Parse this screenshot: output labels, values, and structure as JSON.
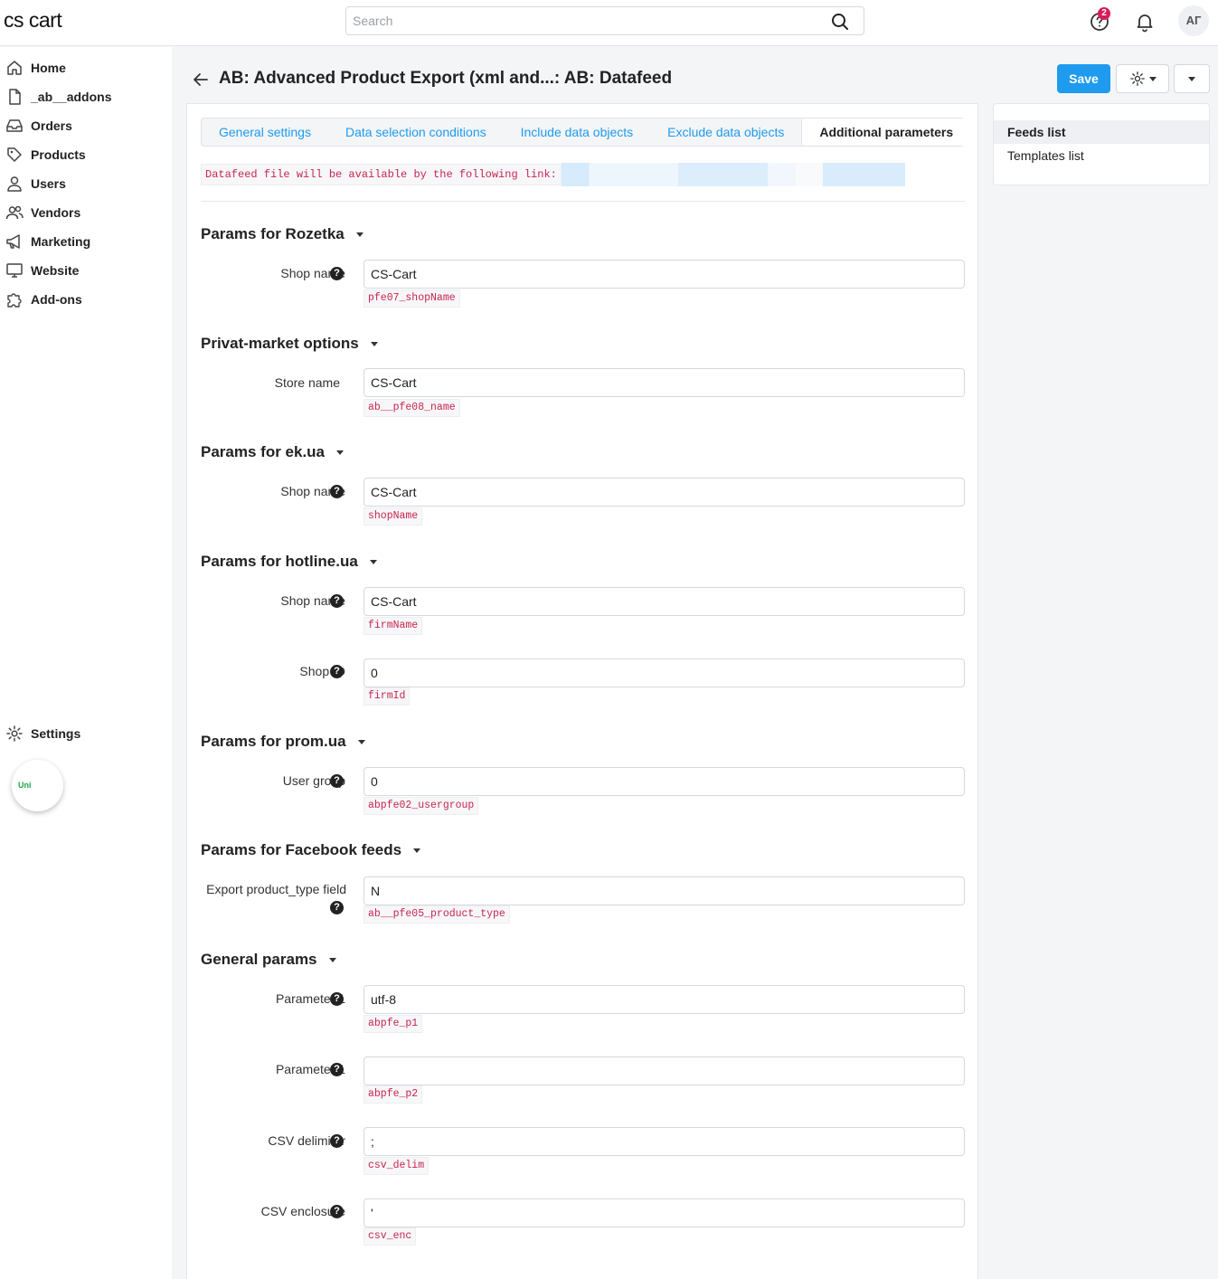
{
  "topbar": {
    "logo": "cs cart",
    "search_placeholder": "Search",
    "notification_count": "2",
    "avatar_initials": "АГ"
  },
  "sidebar": {
    "items": [
      {
        "label": "Home",
        "icon": "home-icon"
      },
      {
        "label": "_ab__addons",
        "icon": "file-icon"
      },
      {
        "label": "Orders",
        "icon": "inbox-icon"
      },
      {
        "label": "Products",
        "icon": "tag-icon"
      },
      {
        "label": "Users",
        "icon": "user-icon"
      },
      {
        "label": "Vendors",
        "icon": "users-icon"
      },
      {
        "label": "Marketing",
        "icon": "megaphone-icon"
      },
      {
        "label": "Website",
        "icon": "monitor-icon"
      },
      {
        "label": "Add-ons",
        "icon": "puzzle-icon"
      }
    ],
    "settings_label": "Settings",
    "uni_label": "Uni"
  },
  "header": {
    "title": "AB: Advanced Product Export (xml and...: AB: Datafeed",
    "save_label": "Save"
  },
  "tabs": [
    {
      "label": "General settings"
    },
    {
      "label": "Data selection conditions"
    },
    {
      "label": "Include data objects"
    },
    {
      "label": "Exclude data objects"
    },
    {
      "label": "Additional parameters"
    }
  ],
  "link_notice": "Datafeed file will be available by the following link:",
  "sections": {
    "rozetka": {
      "title": "Params for Rozetka",
      "rows": [
        {
          "label": "Shop name",
          "value": "CS-Cart",
          "tag": "pfe07_shopName"
        }
      ]
    },
    "privat": {
      "title": "Privat-market options",
      "rows": [
        {
          "label": "Store name",
          "value": "CS-Cart",
          "tag": "ab__pfe08_name"
        }
      ]
    },
    "ekua": {
      "title": "Params for ek.ua",
      "rows": [
        {
          "label": "Shop name",
          "value": "CS-Cart",
          "tag": "shopName"
        }
      ]
    },
    "hotline": {
      "title": "Params for hotline.ua",
      "rows": [
        {
          "label": "Shop name",
          "value": "CS-Cart",
          "tag": "firmName"
        },
        {
          "label": "Shop ID",
          "value": "0",
          "tag": "firmId"
        }
      ]
    },
    "prom": {
      "title": "Params for prom.ua",
      "rows": [
        {
          "label": "User group",
          "value": "0",
          "tag": "abpfe02_usergroup"
        }
      ]
    },
    "facebook": {
      "title": "Params for Facebook feeds",
      "rows": [
        {
          "label": "Export product_type field",
          "value": "N",
          "tag": "ab__pfe05_product_type"
        }
      ]
    },
    "general": {
      "title": "General params",
      "rows": [
        {
          "label": "Parameter 1",
          "value": "utf-8",
          "tag": "abpfe_p1"
        },
        {
          "label": "Parameter 1",
          "value": "",
          "tag": "abpfe_p2"
        },
        {
          "label": "CSV delimiter",
          "value": ";",
          "tag": "csv_delim"
        },
        {
          "label": "CSV enclosure",
          "value": "'",
          "tag": "csv_enc"
        }
      ]
    }
  },
  "right_panel": {
    "items": [
      {
        "label": "Feeds list"
      },
      {
        "label": "Templates list"
      }
    ]
  },
  "colors": {
    "accent": "#1e9bef",
    "code_text": "#c7254e",
    "badge": "#d91c5c"
  }
}
